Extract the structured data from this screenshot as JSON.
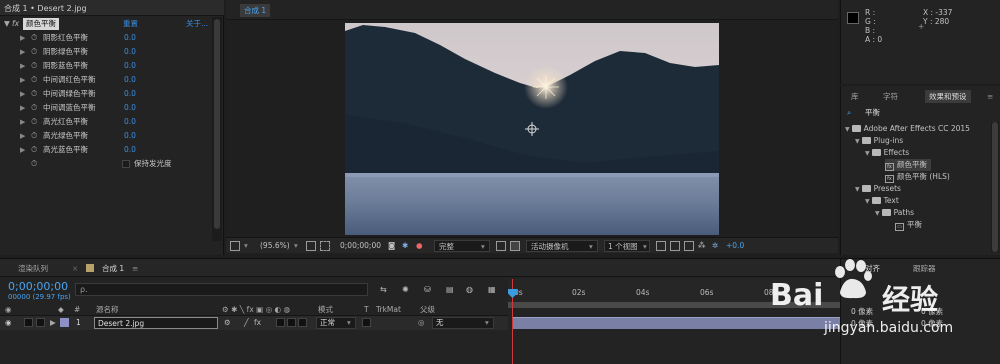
{
  "effect_controls": {
    "title": "合成 1 • Desert 2.jpg",
    "effect_name": "颜色平衡",
    "reset_label": "重置",
    "about_label": "关于...",
    "params": [
      {
        "label": "阴影红色平衡",
        "value": "0.0"
      },
      {
        "label": "阴影绿色平衡",
        "value": "0.0"
      },
      {
        "label": "阴影蓝色平衡",
        "value": "0.0"
      },
      {
        "label": "中间调红色平衡",
        "value": "0.0"
      },
      {
        "label": "中间调绿色平衡",
        "value": "0.0"
      },
      {
        "label": "中间调蓝色平衡",
        "value": "0.0"
      },
      {
        "label": "高光红色平衡",
        "value": "0.0"
      },
      {
        "label": "高光绿色平衡",
        "value": "0.0"
      },
      {
        "label": "高光蓝色平衡",
        "value": "0.0"
      }
    ],
    "preserve_luminosity_label": "保持发光度"
  },
  "composition": {
    "tab_label": "合成 1",
    "toolbar": {
      "zoom": "(95.6%)",
      "timecode": "0;00;00;00",
      "resolution": "完整",
      "camera": "活动摄像机",
      "views": "1 个视图",
      "exposure": "+0.0"
    }
  },
  "info": {
    "r_label": "R :",
    "g_label": "G :",
    "b_label": "B :",
    "a_label": "A : 0",
    "x_label": "X : -337",
    "y_label": "Y : 280",
    "swatch_color": "#000000"
  },
  "effects_presets": {
    "tabs": [
      "库",
      "字符",
      "效果和预设"
    ],
    "search_value": "平衡",
    "tree": [
      {
        "label": "Adobe After Effects CC 2015",
        "type": "folder"
      },
      {
        "label": "Plug-ins",
        "type": "folder"
      },
      {
        "label": "Effects",
        "type": "folder"
      },
      {
        "label": "颜色平衡",
        "type": "effect",
        "selected": true
      },
      {
        "label": "颜色平衡 (HLS)",
        "type": "effect"
      },
      {
        "label": "Presets",
        "type": "folder"
      },
      {
        "label": "Text",
        "type": "folder"
      },
      {
        "label": "Paths",
        "type": "folder"
      },
      {
        "label": "平衡",
        "type": "preset"
      }
    ]
  },
  "timeline": {
    "tabs": [
      "渲染队列",
      "合成 1"
    ],
    "timecode": "0;00;00;00",
    "fps": "00000 (29.97 fps)",
    "search_placeholder": "ρ.",
    "headers": {
      "num": "#",
      "source": "源名称",
      "mode": "模式",
      "t": "T",
      "trkmat": "TrkMat",
      "parent": "父级"
    },
    "layer": {
      "num": "1",
      "name": "Desert 2.jpg",
      "mode": "正常",
      "parent": "无"
    },
    "ticks": [
      "0s",
      "02s",
      "04s",
      "06s",
      "08s"
    ],
    "right_tabs": [
      "对齐",
      "跟踪器"
    ],
    "right_values": [
      "0 像素",
      "0 像素",
      "0 像素",
      "0 像素"
    ]
  },
  "watermark": {
    "brand": "Bai",
    "brand2": "经验",
    "url": "jingyan.baidu.com"
  }
}
